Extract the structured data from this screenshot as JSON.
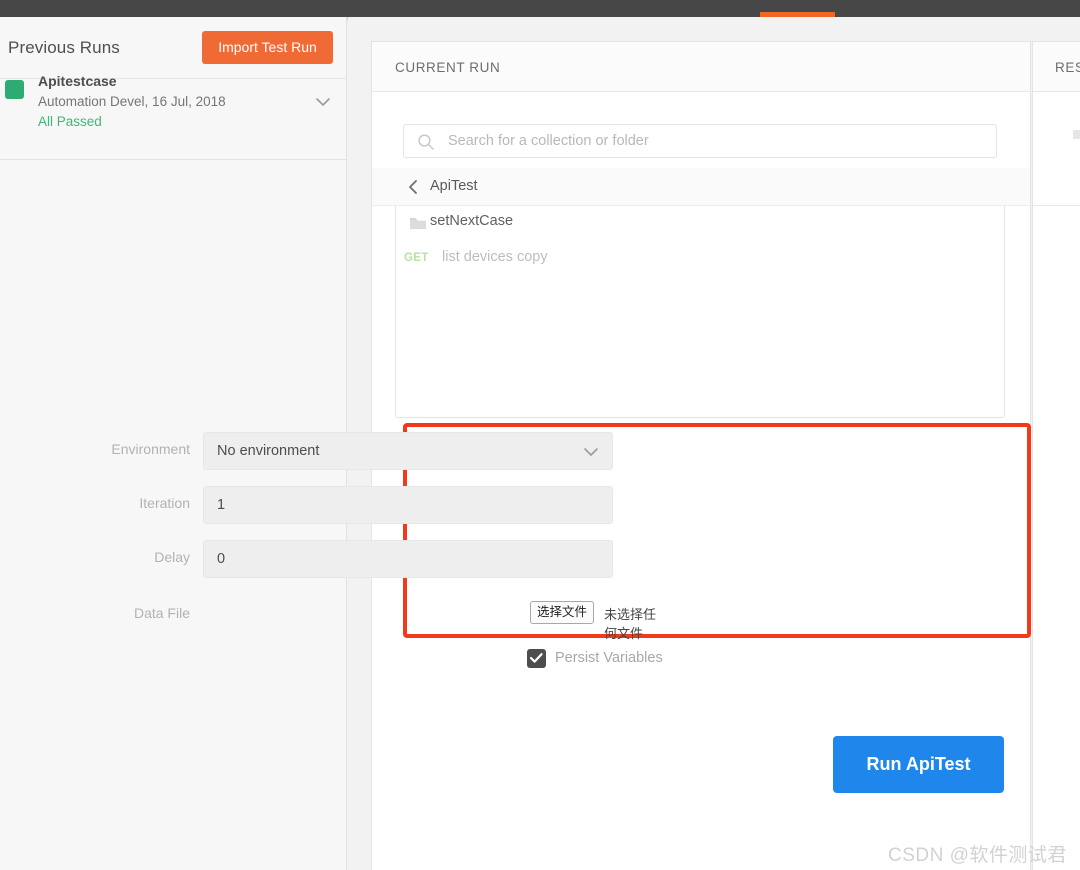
{
  "topbar": {
    "tab_indicator_color": "#f26522",
    "background_color": "#474747"
  },
  "sidebar": {
    "title": "Previous Runs",
    "import_button_label": "Import Test Run",
    "runs": [
      {
        "name": "Apitestcase",
        "details": "Automation Devel, 16 Jul, 2018",
        "status": "All Passed",
        "status_color": "#3cb878",
        "swatch_color": "#2dab72"
      }
    ]
  },
  "main_panel": {
    "header_title": "CURRENT RUN",
    "search": {
      "placeholder": "Search for a collection or folder",
      "value": ""
    },
    "breadcrumb": {
      "label": "ApiTest"
    },
    "collection_items": [
      {
        "type": "folder",
        "label": "setNextCase",
        "method": ""
      },
      {
        "type": "request",
        "label": "list devices copy",
        "method": "GET"
      }
    ],
    "form": {
      "environment": {
        "label": "Environment",
        "value": "No environment"
      },
      "iteration": {
        "label": "Iteration",
        "value": "1"
      },
      "delay": {
        "label": "Delay",
        "value": "0"
      },
      "data_file": {
        "label": "Data File",
        "button_label": "选择文件",
        "status": "未选择任何文件"
      }
    },
    "persist_variables": {
      "label": "Persist Variables",
      "checked": true
    },
    "run_button_label": "Run ApiTest",
    "run_button_color": "#1f87ec",
    "highlight_box_color": "#f4391a"
  },
  "results_panel": {
    "header_title": "RESULTS"
  },
  "watermark": {
    "text": "CSDN @软件测试君"
  }
}
